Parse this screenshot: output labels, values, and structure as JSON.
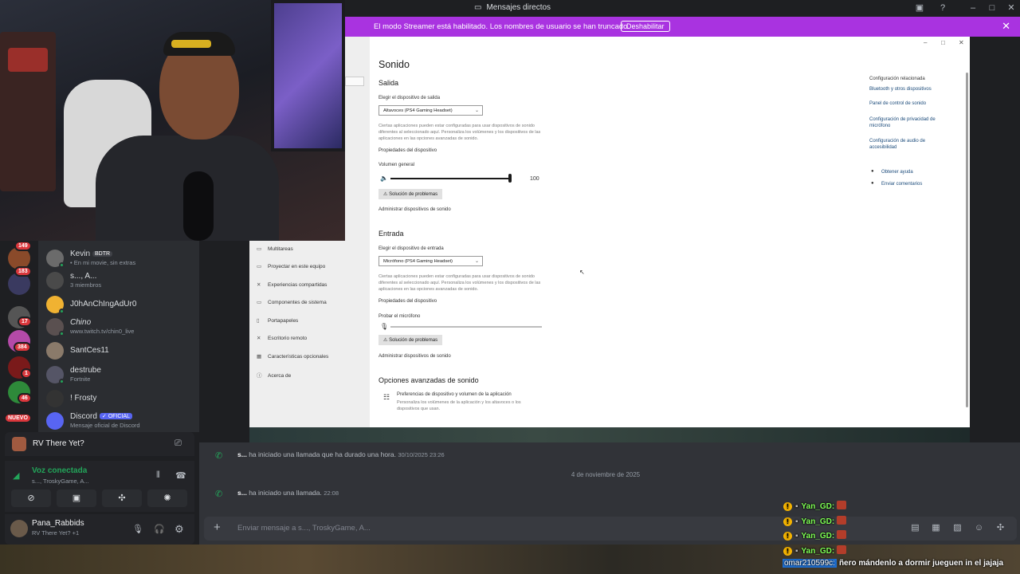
{
  "titlebar": {
    "title": "Mensajes directos"
  },
  "streamer_banner": {
    "message": "El modo Streamer está habilitado. Los nombres de usuario se han truncado.",
    "disable_label": "Deshabilitar"
  },
  "rail": {
    "badges": [
      "149",
      "183",
      "17",
      "384",
      "1",
      "46"
    ],
    "new_label": "NUEVO"
  },
  "dms": [
    {
      "name": "Kevin",
      "tag": "BDTR",
      "sub": "• En mi movie, sin extras"
    },
    {
      "name": "s..., A...",
      "tag": "",
      "sub": "3 miembros"
    },
    {
      "name": "J0hAnChIngAdUr0",
      "tag": "",
      "sub": ""
    },
    {
      "name": "Chino",
      "tag": "",
      "sub": "www.twitch.tv/chin0_live"
    },
    {
      "name": "SantCes11",
      "tag": "",
      "sub": ""
    },
    {
      "name": "destrube",
      "tag": "",
      "sub": "Fortnite"
    },
    {
      "name": "! Frosty",
      "tag": "",
      "sub": ""
    },
    {
      "name": "Discord",
      "tag": "✓ OFICIAL",
      "sub": "Mensaje oficial de Discord"
    }
  ],
  "activity": {
    "game": "RV There Yet?"
  },
  "voice": {
    "status": "Voz conectada",
    "channel": "s..., TroskyGame, A..."
  },
  "user": {
    "name": "Pana_Rabbids",
    "status": "RV There Yet? +1"
  },
  "chat": {
    "call1_user": "s...",
    "call1_text": "ha iniciado una llamada que ha durado una hora.",
    "call1_time": "30/10/2025 23:26",
    "date_divider": "4 de noviembre de 2025",
    "call2_user": "s...",
    "call2_text": "ha iniciado una llamada.",
    "call2_time": "22:08",
    "composer_placeholder": "Enviar mensaje a s..., TroskyGame, A..."
  },
  "settings_nav": [
    "Multitareas",
    "Proyectar en este equipo",
    "Experiencias compartidas",
    "Componentes de sistema",
    "Portapapeles",
    "Escritorio remoto",
    "Características opcionales",
    "Acerca de"
  ],
  "settings": {
    "title": "Sonido",
    "output_heading": "Salida",
    "output_choose": "Elegir el dispositivo de salida",
    "output_device": "Altavoces (PS4 Gaming Headset)",
    "output_note": "Ciertas aplicaciones pueden estar configuradas para usar dispositivos de sonido diferentes al seleccionado aquí. Personaliza los volúmenes y los dispositivos de las aplicaciones en las opciones avanzadas de sonido.",
    "device_props": "Propiedades del dispositivo",
    "volume_label": "Volumen general",
    "volume_value": "100",
    "volume_level": 1.0,
    "troubleshoot": "Solución de problemas",
    "manage_devices": "Administrar dispositivos de sonido",
    "input_heading": "Entrada",
    "input_choose": "Elegir el dispositivo de entrada",
    "input_device": "Micrófono (PS4 Gaming Headset)",
    "input_note": "Ciertas aplicaciones pueden estar configuradas para usar dispositivos de sonido diferentes al seleccionado aquí. Personaliza los volúmenes y los dispositivos de las aplicaciones en las opciones avanzadas de sonido.",
    "input_device_props": "Propiedades del dispositivo",
    "test_mic": "Probar el micrófono",
    "mic_level": 0.0,
    "input_troubleshoot": "Solución de problemas",
    "input_manage": "Administrar dispositivos de sonido",
    "advanced_heading": "Opciones avanzadas de sonido",
    "adv_item_title": "Preferencias de dispositivo y volumen de la aplicación",
    "adv_item_desc": "Personaliza los volúmenes de la aplicación y los altavoces o los dispositivos que usan.",
    "related_heading": "Configuración relacionada",
    "related_links": [
      "Bluetooth y otros dispositivos",
      "Panel de control de sonido",
      "Configuración de privacidad de micrófono",
      "Configuración de audio de accesibilidad"
    ],
    "help": "Obtener ayuda",
    "feedback": "Enviar comentarios"
  },
  "overlay": {
    "lines": [
      "Yan_GD:",
      "Yan_GD:",
      "Yan_GD:",
      "Yan_GD:"
    ],
    "last_user": "omar210599c:",
    "last_text": "ñero mándenlo a dormir jueguen in el jajaja"
  }
}
